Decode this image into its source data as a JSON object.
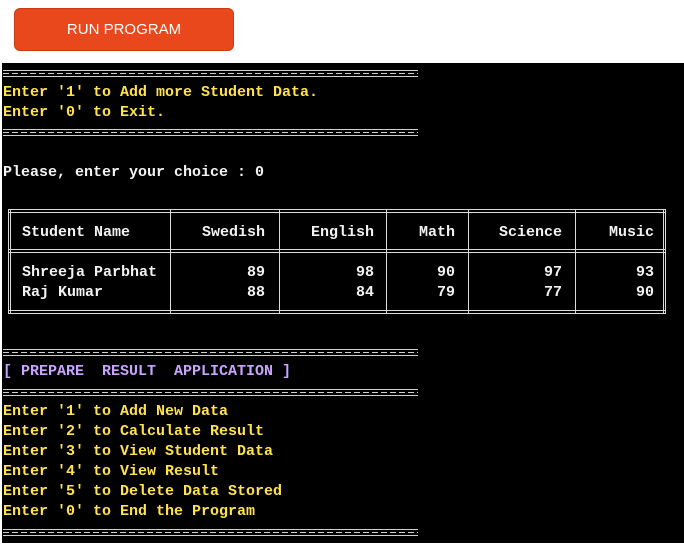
{
  "toolbar": {
    "run_label": "RUN PROGRAM"
  },
  "prompt1": {
    "line1": "Enter '1' to Add more Student Data.",
    "line2": "Enter '0' to Exit."
  },
  "choice_line": "Please, enter your choice : 0",
  "table": {
    "headers": [
      "Student Name",
      "Swedish",
      "English",
      "Math",
      "Science",
      "Music"
    ],
    "rows": [
      [
        "Shreeja Parbhat",
        "89",
        "98",
        "90",
        "97",
        "93"
      ],
      [
        "Raj Kumar",
        "88",
        "84",
        "79",
        "77",
        "90"
      ]
    ]
  },
  "app_title": "[ PREPARE  RESULT  APPLICATION ]",
  "menu": [
    "Enter '1' to Add New Data",
    "Enter '2' to Calculate Result",
    "Enter '3' to View Student Data",
    "Enter '4' to View Result",
    "Enter '5' to Delete Data Stored",
    "Enter '0' to End the Program"
  ],
  "colors": {
    "button": "#e8481b",
    "console_bg": "#000000",
    "prompt_text": "#ffe24d",
    "plain_text": "#f2f2f2",
    "title_text": "#c9a4ff"
  }
}
